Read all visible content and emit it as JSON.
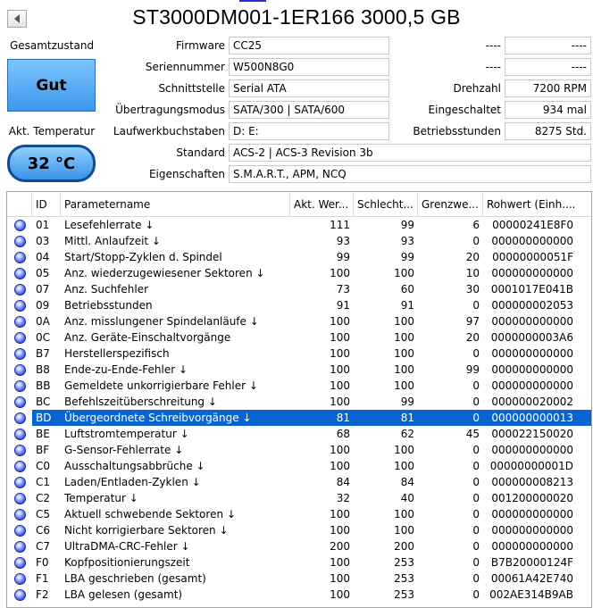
{
  "title": "ST3000DM001-1ER166 3000,5 GB",
  "status": {
    "label": "Gesamtzustand",
    "value": "Gut"
  },
  "temperature": {
    "label": "Akt. Temperatur",
    "value": "32 °C"
  },
  "fields": {
    "firmware": {
      "label": "Firmware",
      "value": "CC25"
    },
    "serial": {
      "label": "Seriennummer",
      "value": "W500N8G0"
    },
    "interface": {
      "label": "Schnittstelle",
      "value": "Serial ATA"
    },
    "transfer": {
      "label": "Übertragungsmodus",
      "value": "SATA/300 | SATA/600"
    },
    "drive_letters": {
      "label": "Laufwerkbuchstaben",
      "value": "D: E:"
    },
    "standard": {
      "label": "Standard",
      "value": "ACS-2 | ACS-3 Revision 3b"
    },
    "features": {
      "label": "Eigenschaften",
      "value": "S.M.A.R.T., APM, NCQ"
    },
    "right_blank1": {
      "label": "----",
      "value": "----"
    },
    "right_blank2": {
      "label": "----",
      "value": "----"
    },
    "rpm": {
      "label": "Drehzahl",
      "value": "7200 RPM"
    },
    "power_on_count": {
      "label": "Eingeschaltet",
      "value": "934 mal"
    },
    "power_on_hours": {
      "label": "Betriebsstunden",
      "value": "8275 Std."
    }
  },
  "table": {
    "headers": [
      "",
      "ID",
      "Parametername",
      "Akt. Wer...",
      "Schlecht...",
      "Grenzwe...",
      "Rohwert (Einh...."
    ],
    "rows": [
      {
        "id": "01",
        "name": "Lesefehlerrate ↓",
        "cur": "111",
        "worst": "99",
        "thr": "6",
        "raw": "00000241E8F0"
      },
      {
        "id": "03",
        "name": "Mittl. Anlaufzeit ↓",
        "cur": "93",
        "worst": "93",
        "thr": "0",
        "raw": "000000000000"
      },
      {
        "id": "04",
        "name": "Start/Stopp-Zyklen d. Spindel",
        "cur": "99",
        "worst": "99",
        "thr": "20",
        "raw": "00000000051F"
      },
      {
        "id": "05",
        "name": "Anz. wiederzugewiesener Sektoren ↓",
        "cur": "100",
        "worst": "100",
        "thr": "10",
        "raw": "000000000000"
      },
      {
        "id": "07",
        "name": "Anz. Suchfehler",
        "cur": "73",
        "worst": "60",
        "thr": "30",
        "raw": "0001017E041B"
      },
      {
        "id": "09",
        "name": "Betriebsstunden",
        "cur": "91",
        "worst": "91",
        "thr": "0",
        "raw": "000000002053"
      },
      {
        "id": "0A",
        "name": "Anz. misslungener Spindelanläufe ↓",
        "cur": "100",
        "worst": "100",
        "thr": "97",
        "raw": "000000000000"
      },
      {
        "id": "0C",
        "name": "Anz. Geräte-Einschaltvorgänge",
        "cur": "100",
        "worst": "100",
        "thr": "20",
        "raw": "0000000003A6"
      },
      {
        "id": "B7",
        "name": "Herstellerspezifisch",
        "cur": "100",
        "worst": "100",
        "thr": "0",
        "raw": "000000000000"
      },
      {
        "id": "B8",
        "name": "Ende-zu-Ende-Fehler ↓",
        "cur": "100",
        "worst": "100",
        "thr": "99",
        "raw": "000000000000"
      },
      {
        "id": "BB",
        "name": "Gemeldete unkorrigierbare Fehler ↓",
        "cur": "100",
        "worst": "100",
        "thr": "0",
        "raw": "000000000000"
      },
      {
        "id": "BC",
        "name": "Befehlszeitüberschreitung ↓",
        "cur": "100",
        "worst": "99",
        "thr": "0",
        "raw": "000000020002"
      },
      {
        "id": "BD",
        "name": "Übergeordnete Schreibvorgänge ↓",
        "cur": "81",
        "worst": "81",
        "thr": "0",
        "raw": "000000000013",
        "selected": true
      },
      {
        "id": "BE",
        "name": "Luftstromtemperatur ↓",
        "cur": "68",
        "worst": "62",
        "thr": "45",
        "raw": "000022150020"
      },
      {
        "id": "BF",
        "name": "G-Sensor-Fehlerrate ↓",
        "cur": "100",
        "worst": "100",
        "thr": "0",
        "raw": "000000000000"
      },
      {
        "id": "C0",
        "name": "Ausschaltungsabbrüche ↓",
        "cur": "100",
        "worst": "100",
        "thr": "0",
        "raw": "00000000001D"
      },
      {
        "id": "C1",
        "name": "Laden/Entladen-Zyklen ↓",
        "cur": "84",
        "worst": "84",
        "thr": "0",
        "raw": "000000008213"
      },
      {
        "id": "C2",
        "name": "Temperatur ↓",
        "cur": "32",
        "worst": "40",
        "thr": "0",
        "raw": "001200000020"
      },
      {
        "id": "C5",
        "name": "Aktuell schwebende Sektoren ↓",
        "cur": "100",
        "worst": "100",
        "thr": "0",
        "raw": "000000000000"
      },
      {
        "id": "C6",
        "name": "Nicht korrigierbare Sektoren ↓",
        "cur": "100",
        "worst": "100",
        "thr": "0",
        "raw": "000000000000"
      },
      {
        "id": "C7",
        "name": "UltraDMA-CRC-Fehler ↓",
        "cur": "200",
        "worst": "200",
        "thr": "0",
        "raw": "000000000000"
      },
      {
        "id": "F0",
        "name": "Kopfpositionierungszeit",
        "cur": "100",
        "worst": "253",
        "thr": "0",
        "raw": "B7B20000124F"
      },
      {
        "id": "F1",
        "name": "LBA geschrieben (gesamt)",
        "cur": "100",
        "worst": "253",
        "thr": "0",
        "raw": "00061A42E740"
      },
      {
        "id": "F2",
        "name": "LBA gelesen (gesamt)",
        "cur": "100",
        "worst": "253",
        "thr": "0",
        "raw": "002AE314B9AB"
      }
    ]
  },
  "colors": {
    "good": "#3d97ec",
    "selected_row": "#0a64d0",
    "health_dot": "#3a57e8"
  },
  "icons": {
    "back": "left-arrow-icon",
    "health": "blue-circle-icon"
  }
}
